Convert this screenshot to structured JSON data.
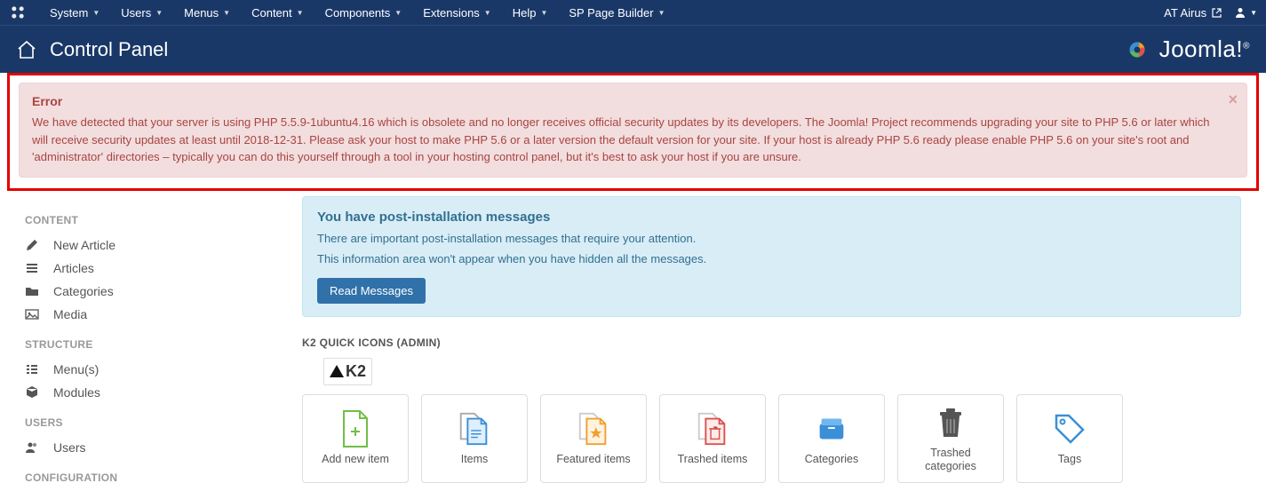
{
  "topbar": {
    "menu": [
      "System",
      "Users",
      "Menus",
      "Content",
      "Components",
      "Extensions",
      "Help",
      "SP Page Builder"
    ],
    "site_name": "AT Airus"
  },
  "header": {
    "title": "Control Panel",
    "brand": "Joomla!"
  },
  "alert": {
    "title": "Error",
    "body": "We have detected that your server is using PHP 5.5.9-1ubuntu4.16 which is obsolete and no longer receives official security updates by its developers. The Joomla! Project recommends upgrading your site to PHP 5.6 or later which will receive security updates at least until 2018-12-31. Please ask your host to make PHP 5.6 or a later version the default version for your site. If your host is already PHP 5.6 ready please enable PHP 5.6 on your site's root and 'administrator' directories – typically you can do this yourself through a tool in your hosting control panel, but it's best to ask your host if you are unsure."
  },
  "sidebar": {
    "sections": {
      "content": {
        "title": "CONTENT",
        "items": [
          "New Article",
          "Articles",
          "Categories",
          "Media"
        ]
      },
      "structure": {
        "title": "STRUCTURE",
        "items": [
          "Menu(s)",
          "Modules"
        ]
      },
      "users": {
        "title": "USERS",
        "items": [
          "Users"
        ]
      },
      "configuration": {
        "title": "CONFIGURATION"
      }
    }
  },
  "post_messages": {
    "heading": "You have post-installation messages",
    "line1": "There are important post-installation messages that require your attention.",
    "line2": "This information area won't appear when you have hidden all the messages.",
    "button": "Read Messages"
  },
  "k2": {
    "panel_title": "K2 QUICK ICONS (ADMIN)",
    "logo": "K2",
    "icons": [
      {
        "label": "Add new item",
        "color": "#6fbf44",
        "type": "add"
      },
      {
        "label": "Items",
        "color": "#3b8fd6",
        "type": "docs"
      },
      {
        "label": "Featured items",
        "color": "#f0a030",
        "type": "star"
      },
      {
        "label": "Trashed items",
        "color": "#d9534f",
        "type": "trash-doc"
      },
      {
        "label": "Categories",
        "color": "#3b8fd6",
        "type": "folder"
      },
      {
        "label": "Trashed categories",
        "color": "#555",
        "type": "trash"
      },
      {
        "label": "Tags",
        "color": "#3b8fd6",
        "type": "tag"
      }
    ]
  }
}
